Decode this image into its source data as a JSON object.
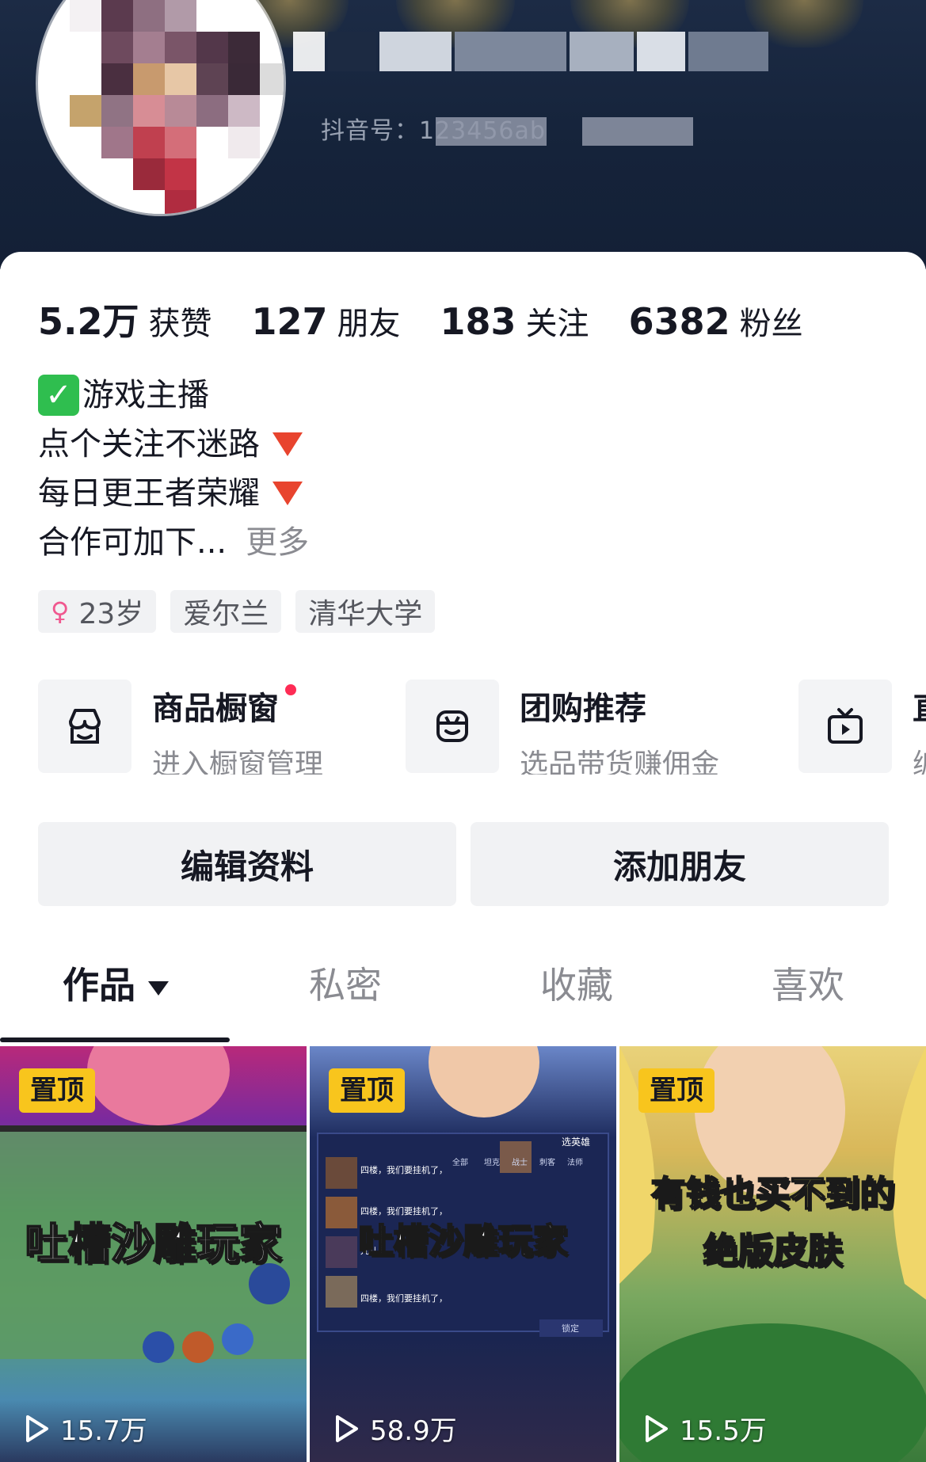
{
  "profile": {
    "douyin_id_prefix": "抖音号：123456ab"
  },
  "stats": [
    {
      "num": "5.2万",
      "label": "获赞"
    },
    {
      "num": "127",
      "label": "朋友"
    },
    {
      "num": "183",
      "label": "关注"
    },
    {
      "num": "6382",
      "label": "粉丝"
    }
  ],
  "bio": {
    "check_mark": "✓",
    "line1": "游戏主播",
    "line2": "点个关注不迷路",
    "line3": "每日更王者荣耀",
    "line4": "合作可加下...",
    "more_label": "更多"
  },
  "tags": {
    "gender_icon": "♀",
    "age": "23岁",
    "location": "爱尔兰",
    "school": "清华大学"
  },
  "services": [
    {
      "icon": "store-icon",
      "title": "商品橱窗",
      "subtitle": "进入橱窗管理",
      "has_dot": true
    },
    {
      "icon": "group-buy-icon",
      "title": "团购推荐",
      "subtitle": "选品带货赚佣金"
    },
    {
      "icon": "tv-icon",
      "title": "直",
      "subtitle": "编"
    }
  ],
  "buttons": {
    "edit": "编辑资料",
    "add_friend": "添加朋友"
  },
  "tabs": [
    {
      "label": "作品",
      "active": true
    },
    {
      "label": "私密"
    },
    {
      "label": "收藏"
    },
    {
      "label": "喜欢"
    }
  ],
  "videos": [
    {
      "pinned_label": "置顶",
      "title_line1": "吐槽沙雕玩家",
      "views": "15.7万"
    },
    {
      "pinned_label": "置顶",
      "title_line1": "吐槽沙雕玩家",
      "views": "58.9万",
      "ui_labels": {
        "select": "选英雄",
        "all": "全部",
        "tank": "坦克",
        "fighter": "战士",
        "assassin": "刺客",
        "mage": "法师",
        "lock": "锁定",
        "chat1": "四楼，我们要挂机了，",
        "chat2": "四楼，我们要挂机了，",
        "chat3": "九儿",
        "chat4": "四楼，我们要挂机了，"
      }
    },
    {
      "pinned_label": "置顶",
      "title_line1": "有钱也买不到的",
      "title_line2": "绝版皮肤",
      "views": "15.5万"
    }
  ],
  "colors": {
    "banner": "#16243b",
    "pin_badge": "#f8c51d",
    "accent_red": "#fe2c55",
    "verified_green": "#2fbe4f"
  }
}
